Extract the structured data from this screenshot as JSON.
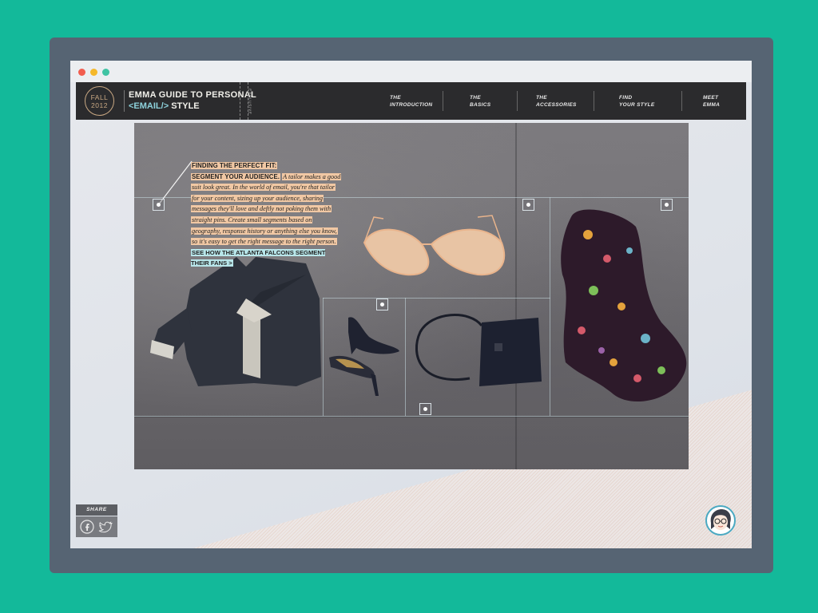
{
  "nav": {
    "badge": {
      "line1": "FALL",
      "line2": "2012"
    },
    "brand": {
      "line1": "EMMA GUIDE TO PERSONAL",
      "email_tag": "<EMAIL/>",
      "style_word": "STYLE"
    },
    "exclusive": "EXCLUSIVE",
    "items": [
      {
        "line1": "THE",
        "line2": "INTRODUCTION"
      },
      {
        "line1": "THE",
        "line2": "BASICS"
      },
      {
        "line1": "THE",
        "line2": "ACCESSORIES"
      },
      {
        "line1": "FIND",
        "line2": "YOUR STYLE"
      },
      {
        "line1": "MEET",
        "line2": "EMMA"
      }
    ]
  },
  "article": {
    "heading": "FINDING THE PERFECT FIT:",
    "subheading": "SEGMENT YOUR AUDIENCE.",
    "body": "A tailor makes a good suit look great. In the world of email, you're that tailor for your content, sizing up your audience, sharing messages they'll love and deftly not poking them with straight pins. Create small segments based on geography, response history or anything else you know, so it's easy to get the right message to the right person.",
    "link": "SEE HOW THE ATLANTA FALCONS SEGMENT THEIR FANS >"
  },
  "share": {
    "label": "SHARE"
  },
  "colors": {
    "background": "#13b99a",
    "navbar": "#2b2b2d",
    "highlight": "#f1c8a4",
    "link_highlight": "#b8e6ea",
    "accent_gold": "#c9a883"
  }
}
